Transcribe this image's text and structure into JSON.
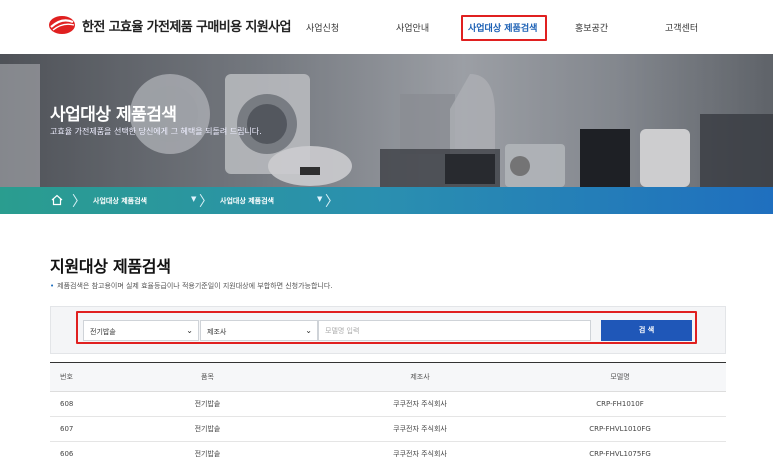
{
  "header": {
    "logo_text": "한전 고효율 가전제품 구매비용 지원사업",
    "nav": [
      {
        "label": "사업신청"
      },
      {
        "label": "사업안내"
      },
      {
        "label": "사업대상 제품검색",
        "active": true
      },
      {
        "label": "홍보공간"
      },
      {
        "label": "고객센터"
      }
    ]
  },
  "hero": {
    "title": "사업대상 제품검색",
    "subtitle": "고효율 가전제품을 선택한 당신에게 그 혜택을 되돌려 드립니다."
  },
  "breadcrumb": {
    "home_icon": "home-icon",
    "items": [
      {
        "label": "사업대상 제품검색"
      },
      {
        "label": "사업대상 제품검색"
      }
    ]
  },
  "main": {
    "title": "지원대상 제품검색",
    "notice": "제품검색은 참고용이며 실제 효율등급이나 적용기준일이 지원대상에 부합하면 신청가능합니다."
  },
  "search": {
    "category_value": "전기밥솥",
    "maker_value": "제조사",
    "model_placeholder": "모델명 입력",
    "button_label": "검 색"
  },
  "table": {
    "headers": [
      "번호",
      "품목",
      "제조사",
      "모델명"
    ],
    "rows": [
      {
        "no": "608",
        "item": "전기밥솥",
        "maker": "쿠쿠전자 주식회사",
        "model": "CRP-FH1010F"
      },
      {
        "no": "607",
        "item": "전기밥솥",
        "maker": "쿠쿠전자 주식회사",
        "model": "CRP-FHVL1010FG"
      },
      {
        "no": "606",
        "item": "전기밥솥",
        "maker": "쿠쿠전자 주식회사",
        "model": "CRP-FHVL1075FG"
      }
    ]
  },
  "colors": {
    "brand_red": "#e02020",
    "primary_blue": "#1f57b8",
    "teal": "#2a9d8f"
  }
}
